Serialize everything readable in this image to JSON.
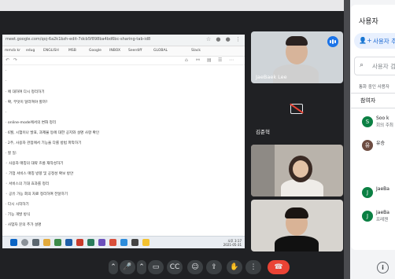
{
  "browser": {
    "url": "meet.google.com/qoj-6a2k1bzh-edit-7dcb5f898ba4bd6bc-sharing-tab-id8",
    "bookmarks": [
      "mmcb kr",
      "edug",
      "ENGLISH",
      "MSB",
      "Google",
      "INBOX",
      "Seerdiff",
      "GLOBAL",
      "Slack"
    ]
  },
  "doc": {
    "lines": [
      "·",
      "·",
      "· 에 대하여 다시 정리하기",
      "· 확, 무엇이 달라져야 할까?",
      "·         ᅟ",
      "· online-mode에서의 변화 정리",
      "· 6월, 시험이나 발표, 과제물 등에 대한 공지와 설명 사항 확인",
      "· 2주, 사용자 관점에서 기능을 다룰 방법 파악하기",
      "· 할 일:",
      "   ◦ 사용자 매칭의 대략 흐름 재작성하기",
      "   ◦ 기업 서비스 매칭 방향 및 공정성 확보 방안",
      "   ◦ 서비스의 기대 효과를 정리",
      "   ◦ 공유 가능 회의 자료 정리하여 전달하기",
      "· 다시 시작하기",
      "· 기능 개발 방식",
      "· 사업자 문의 추가 설명"
    ]
  },
  "taskbar": {
    "time": "오후 3:17",
    "date": "2021-05-31"
  },
  "tiles": {
    "t1": {
      "name": "JaeBaek Lee"
    },
    "t2": {
      "name": "김준혁"
    },
    "t3": {
      "name": ""
    },
    "t4": {
      "name": ""
    }
  },
  "controls": {
    "items": [
      {
        "name": "more-options-button",
        "glyph": "⌃"
      },
      {
        "name": "microphone-button",
        "glyph": "🎤"
      },
      {
        "name": "camera-options-button",
        "glyph": "⌃"
      },
      {
        "name": "camera-button",
        "glyph": "▭"
      },
      {
        "name": "captions-button",
        "glyph": "CC"
      },
      {
        "name": "emoji-button",
        "glyph": "☺"
      },
      {
        "name": "present-button",
        "glyph": "⇪"
      },
      {
        "name": "raise-hand-button",
        "glyph": "✋"
      },
      {
        "name": "more-button",
        "glyph": "⋮"
      },
      {
        "name": "end-call-button",
        "glyph": "☎"
      }
    ]
  },
  "panel": {
    "title": "사용자",
    "add_label": "사용자 추가",
    "search_placeholder": "사용자 검색",
    "section_label": "통화 중인 사용자",
    "section_head": "참여자",
    "people": [
      {
        "initial": "S",
        "color": "#0b8043",
        "name": "Soo k",
        "sub": "회의 주최"
      },
      {
        "initial": "유",
        "color": "#6d4c41",
        "name": "유승",
        "sub": ""
      },
      {
        "initial": "",
        "color": "#ffffff",
        "name": "",
        "sub": ""
      },
      {
        "initial": "J",
        "color": "#0b8043",
        "name": "JaeBa",
        "sub": ""
      },
      {
        "initial": "J",
        "color": "#0b8043",
        "name": "JaeBa",
        "sub": "프레젠"
      }
    ]
  }
}
